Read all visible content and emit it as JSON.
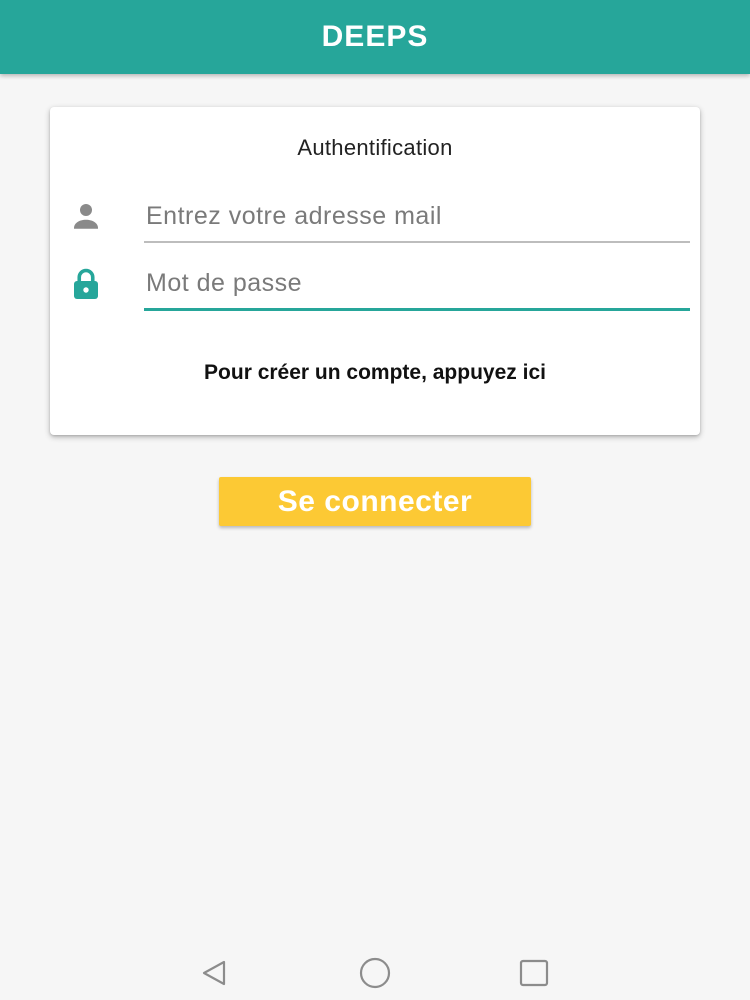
{
  "appbar": {
    "title": "DEEPS",
    "color": "#26a69a"
  },
  "card": {
    "title": "Authentification",
    "email_field": {
      "icon": "person-icon",
      "placeholder": "Entrez votre adresse mail",
      "value": ""
    },
    "password_field": {
      "icon": "lock-icon",
      "placeholder": "Mot de passe",
      "value": ""
    },
    "register_link": "Pour créer un compte, appuyez ici"
  },
  "login_button": {
    "label": "Se connecter",
    "color": "#fcc934"
  },
  "navbar": {
    "icons": [
      "back-triangle-icon",
      "home-circle-icon",
      "recent-apps-square-icon"
    ]
  }
}
